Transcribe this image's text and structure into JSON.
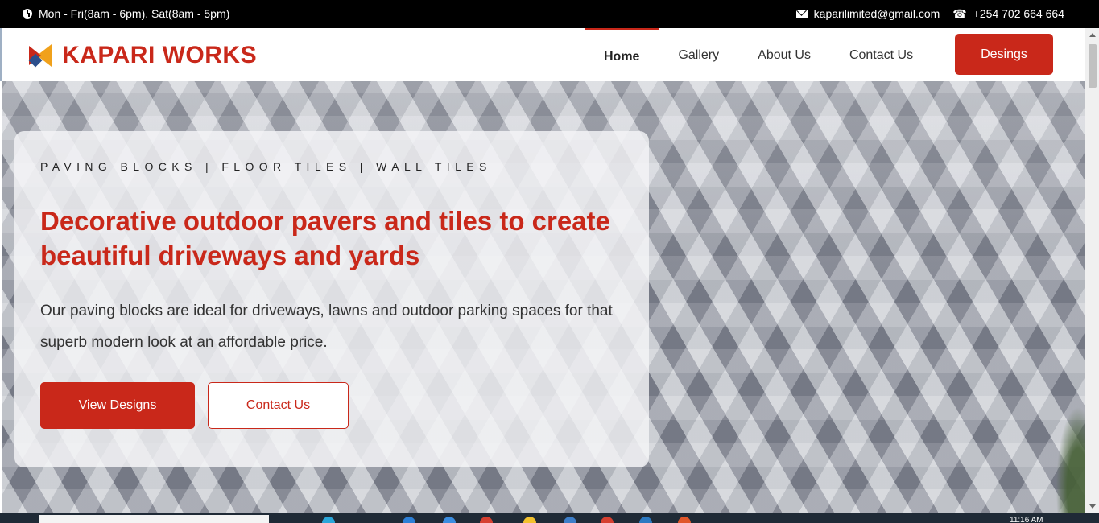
{
  "topbar": {
    "hours": "Mon - Fri(8am - 6pm), Sat(8am - 5pm)",
    "email": "kaparilimited@gmail.com",
    "phone": "+254 702 664 664"
  },
  "brand": {
    "name": "KAPARI WORKS",
    "accent": "#c9281a"
  },
  "nav": {
    "items": [
      {
        "label": "Home",
        "active": true
      },
      {
        "label": "Gallery",
        "active": false
      },
      {
        "label": "About Us",
        "active": false
      },
      {
        "label": "Contact Us",
        "active": false
      }
    ],
    "cta_label": "Desings"
  },
  "hero": {
    "tagline": "PAVING BLOCKS | FLOOR TILES | WALL TILES",
    "headline": "Decorative outdoor pavers and tiles to create beautiful driveways and yards",
    "description": "Our paving blocks are ideal for driveways, lawns and outdoor parking spaces for that superb modern look at an affordable price.",
    "primary_button": "View Designs",
    "secondary_button": "Contact Us"
  },
  "taskbar": {
    "time": "11:16 AM"
  },
  "icons": {
    "hours": "clock-icon",
    "email": "mail-icon",
    "phone": "phone-icon",
    "logo": "logo-mark-icon"
  }
}
